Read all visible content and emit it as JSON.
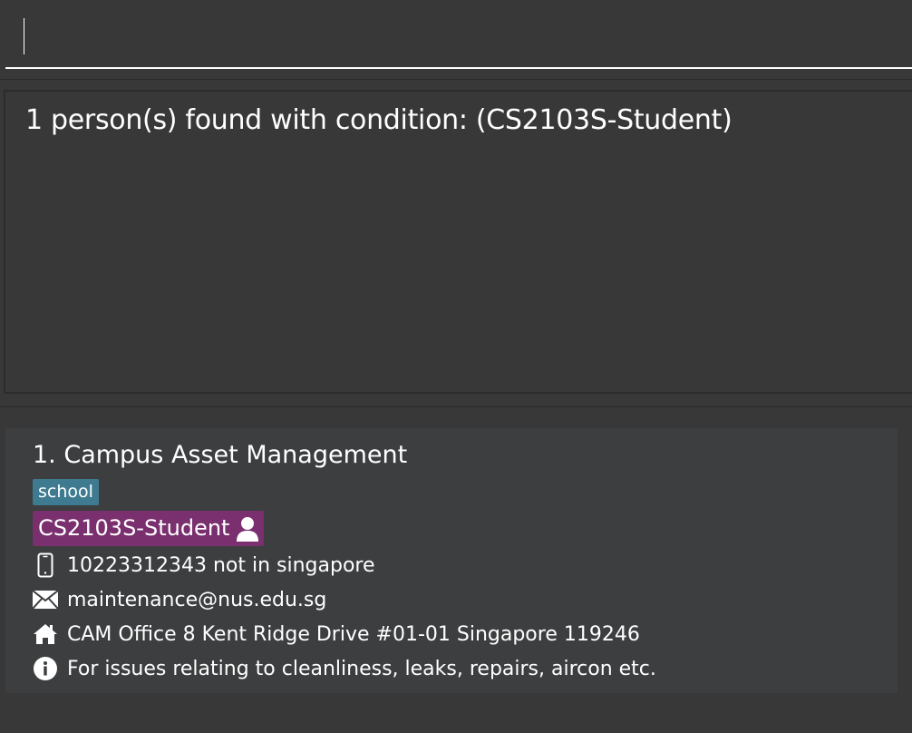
{
  "command_box": {
    "value": "",
    "placeholder": ""
  },
  "result_display": {
    "message": "1 person(s) found with condition: (CS2103S-Student)"
  },
  "person_list": {
    "persons": [
      {
        "title": "1. Campus Asset Management",
        "tags": [
          "school"
        ],
        "group": "CS2103S-Student",
        "phone": "10223312343 not in singapore",
        "email": "maintenance@nus.edu.sg",
        "address": "CAM Office 8 Kent Ridge Drive #01-01 Singapore 119246",
        "description": "For issues relating to cleanliness, leaks, repairs, aircon etc."
      }
    ]
  },
  "colors": {
    "background": "#383838",
    "card_background": "#3c3e3f",
    "tag_school": "#3e7b91",
    "tag_group": "#7a2f6f",
    "text": "#ffffff"
  },
  "icons": {
    "group": "person-icon",
    "phone": "phone-icon",
    "email": "envelope-icon",
    "address": "home-icon",
    "description": "info-icon"
  }
}
